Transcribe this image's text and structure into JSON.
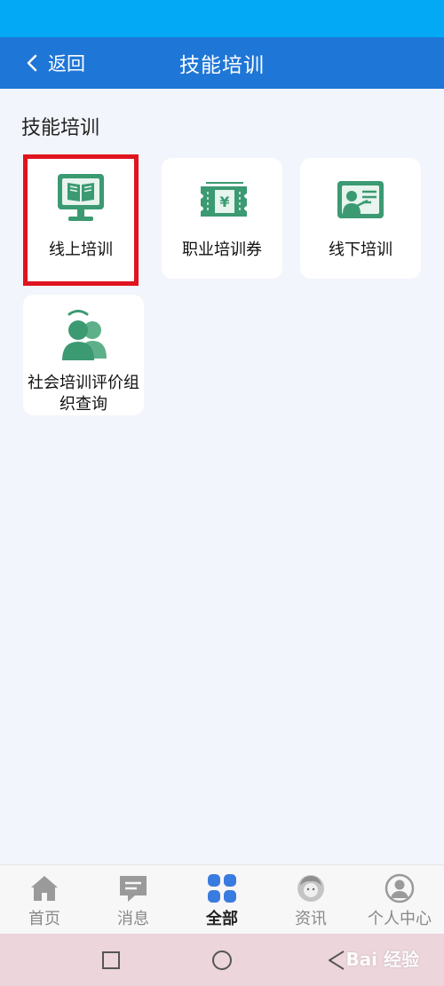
{
  "nav": {
    "back_label": "返回",
    "title": "技能培训"
  },
  "section": {
    "title": "技能培训"
  },
  "services": [
    {
      "label": "线上培训",
      "icon": "monitor-book-icon",
      "highlighted": true
    },
    {
      "label": "职业培训券",
      "icon": "voucher-ticket-icon"
    },
    {
      "label": "线下培训",
      "icon": "teacher-board-icon"
    },
    {
      "label": "社会培训评价组织查询",
      "icon": "people-group-icon"
    }
  ],
  "bottom_tabs": [
    {
      "label": "首页",
      "icon": "home-icon",
      "active": false
    },
    {
      "label": "消息",
      "icon": "message-icon",
      "active": false
    },
    {
      "label": "全部",
      "icon": "grid-icon",
      "active": true
    },
    {
      "label": "资讯",
      "icon": "news-avatar-icon",
      "active": false
    },
    {
      "label": "个人中心",
      "icon": "user-icon",
      "active": false
    }
  ],
  "watermark": "Bai 经验",
  "colors": {
    "status_bar": "#03a9f4",
    "nav_bar": "#1e76d6",
    "icon_green": "#3b9a72",
    "highlight": "#e0141e",
    "active_tab": "#3a7be0"
  }
}
